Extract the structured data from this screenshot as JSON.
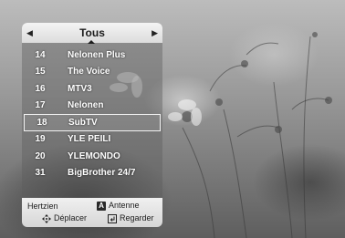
{
  "category": {
    "title": "Tous",
    "prev_icon": "triangle-left-icon",
    "next_icon": "triangle-right-icon"
  },
  "channels": [
    {
      "number": "14",
      "name": "Nelonen Plus"
    },
    {
      "number": "15",
      "name": "The Voice"
    },
    {
      "number": "16",
      "name": "MTV3"
    },
    {
      "number": "17",
      "name": "Nelonen"
    },
    {
      "number": "18",
      "name": "SubTV"
    },
    {
      "number": "19",
      "name": "YLE PEILI"
    },
    {
      "number": "20",
      "name": "YLEMONDO"
    },
    {
      "number": "31",
      "name": "BigBrother 24/7"
    }
  ],
  "selected_index": 4,
  "footer": {
    "source_label": "Hertzien",
    "antenna_key": "A",
    "antenna_label": "Antenne",
    "move_icon": "four-way-arrows-icon",
    "move_label": "Déplacer",
    "watch_icon": "enter-return-icon",
    "watch_label": "Regarder"
  }
}
